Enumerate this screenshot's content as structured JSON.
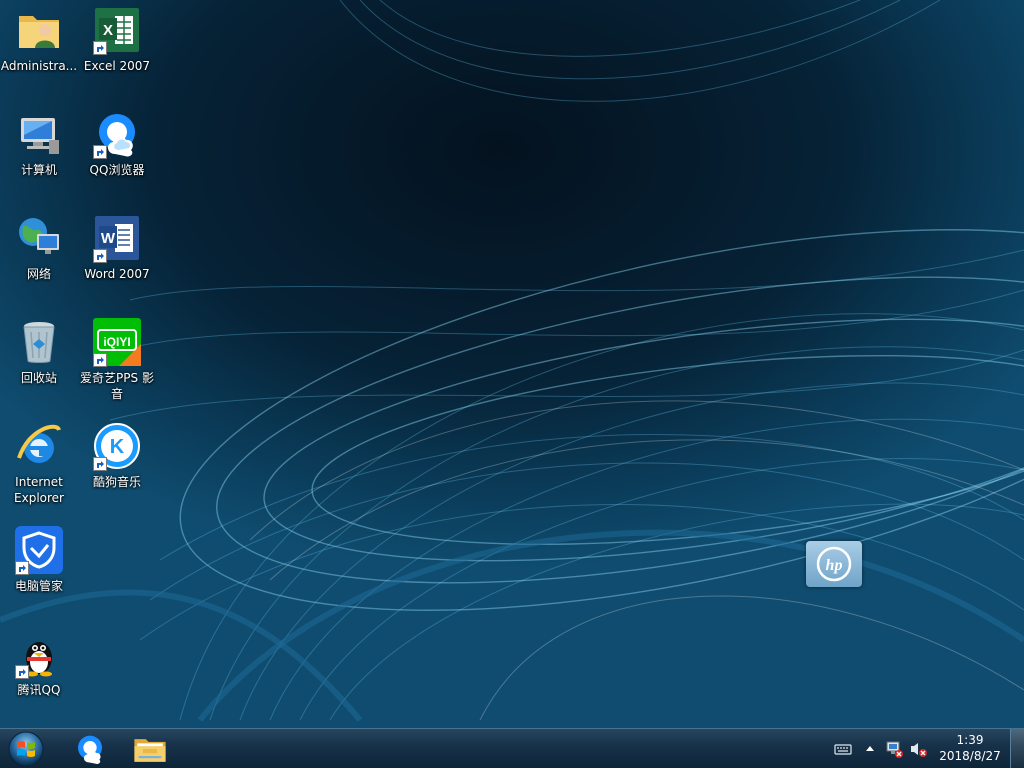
{
  "desktop": {
    "icons": [
      {
        "label": "Administra...",
        "icon": "user-folder-icon"
      },
      {
        "label": "Excel 2007",
        "icon": "excel-icon"
      },
      {
        "label": "计算机",
        "icon": "computer-icon"
      },
      {
        "label": "QQ浏览器",
        "icon": "qq-browser-icon"
      },
      {
        "label": "网络",
        "icon": "network-icon"
      },
      {
        "label": "Word 2007",
        "icon": "word-icon"
      },
      {
        "label": "回收站",
        "icon": "recycle-bin-icon"
      },
      {
        "label": "爱奇艺PPS 影音",
        "icon": "iqiyi-icon"
      },
      {
        "label": "Internet Explorer",
        "icon": "internet-explorer-icon"
      },
      {
        "label": "酷狗音乐",
        "icon": "kugou-icon"
      },
      {
        "label": "电脑管家",
        "icon": "tencent-pc-manager-icon"
      },
      {
        "label": "腾讯QQ",
        "icon": "qq-penguin-icon"
      }
    ],
    "excel_glyph": "X",
    "word_glyph": "W",
    "iqiyi_glyph": "iQIYI",
    "kugou_glyph": "K",
    "wallpaper_logo": "hp"
  },
  "taskbar": {
    "start": {
      "icon": "windows-start-orb-icon"
    },
    "pinned": [
      {
        "icon": "qq-browser-icon"
      },
      {
        "icon": "file-explorer-icon"
      }
    ],
    "tray": {
      "icons": [
        "keyboard-icon",
        "show-hidden-icons-chevron-icon",
        "network-disconnected-icon",
        "volume-muted-icon"
      ]
    },
    "clock": {
      "time": "1:39",
      "date": "2018/8/27"
    }
  },
  "colors": {
    "taskbar": "#17324a",
    "wallpaper_dark": "#04121f",
    "wallpaper_light": "#0f4c6f",
    "excel_green": "#1e7145",
    "word_blue": "#2b579a",
    "iqiyi_green": "#00be06"
  }
}
